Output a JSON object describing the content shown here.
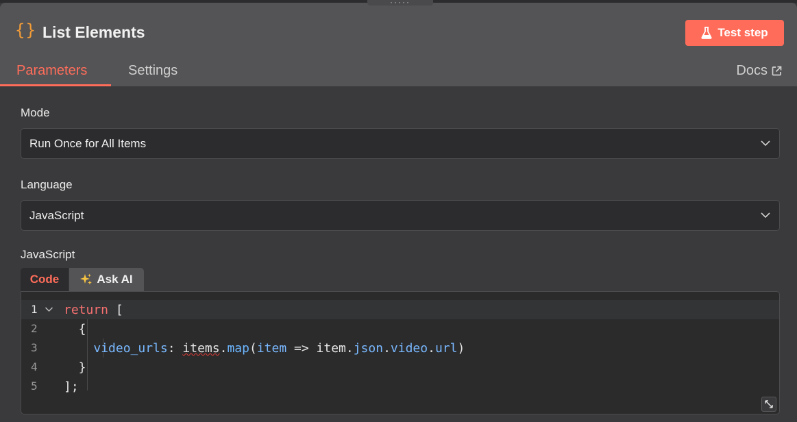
{
  "header": {
    "icon": "braces-icon",
    "icon_glyph": "{}",
    "title": "List Elements",
    "test_button_label": "Test step",
    "accent_color": "#ff6d5a"
  },
  "tabs": [
    {
      "label": "Parameters",
      "active": true
    },
    {
      "label": "Settings",
      "active": false
    }
  ],
  "docs_label": "Docs",
  "fields": {
    "mode": {
      "label": "Mode",
      "value": "Run Once for All Items"
    },
    "language": {
      "label": "Language",
      "value": "JavaScript"
    },
    "code": {
      "label": "JavaScript"
    }
  },
  "code_tabs": [
    {
      "label": "Code",
      "active": true
    },
    {
      "label": "Ask AI",
      "icon": "sparkles-icon",
      "active": false
    }
  ],
  "code_lines": [
    {
      "number": "1",
      "text": "return ["
    },
    {
      "number": "2",
      "text": "  {"
    },
    {
      "number": "3",
      "text": "    video_urls: items.map(item => item.json.video.url)"
    },
    {
      "number": "4",
      "text": "  }"
    },
    {
      "number": "5",
      "text": "];"
    }
  ]
}
